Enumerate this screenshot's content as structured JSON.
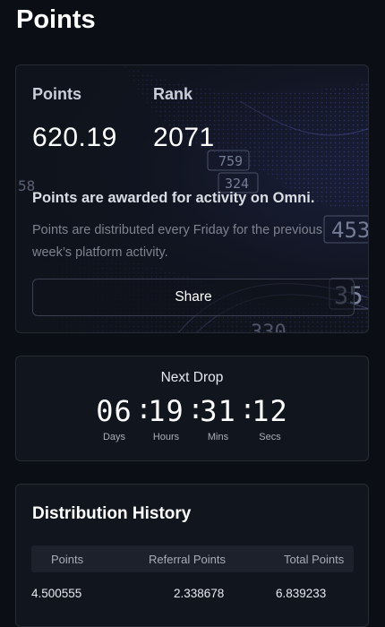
{
  "page": {
    "title": "Points"
  },
  "summary": {
    "points_label": "Points",
    "points_value": "620.19",
    "rank_label": "Rank",
    "rank_value": "2071",
    "awarded_title": "Points are awarded for activity on Omni.",
    "awarded_desc": "Points are distributed every Friday for the previous week’s platform activity.",
    "share_label": "Share",
    "decor_numbers": [
      "759",
      "324",
      "58",
      "453",
      "35",
      "330"
    ]
  },
  "next_drop": {
    "title": "Next Drop",
    "units": [
      {
        "value": "06",
        "label": "Days"
      },
      {
        "value": "19",
        "label": "Hours"
      },
      {
        "value": "31",
        "label": "Mins"
      },
      {
        "value": "12",
        "label": "Secs"
      }
    ],
    "separator": ":"
  },
  "history": {
    "title": "Distribution History",
    "columns": [
      "Points",
      "Referral Points",
      "Total Points"
    ],
    "rows": [
      [
        "4.500555",
        "2.338678",
        "6.839233"
      ]
    ]
  },
  "colors": {
    "background": "#0b0e14",
    "card": "#11151d",
    "border": "#262b35",
    "accent_wave": "#4a55c8"
  }
}
